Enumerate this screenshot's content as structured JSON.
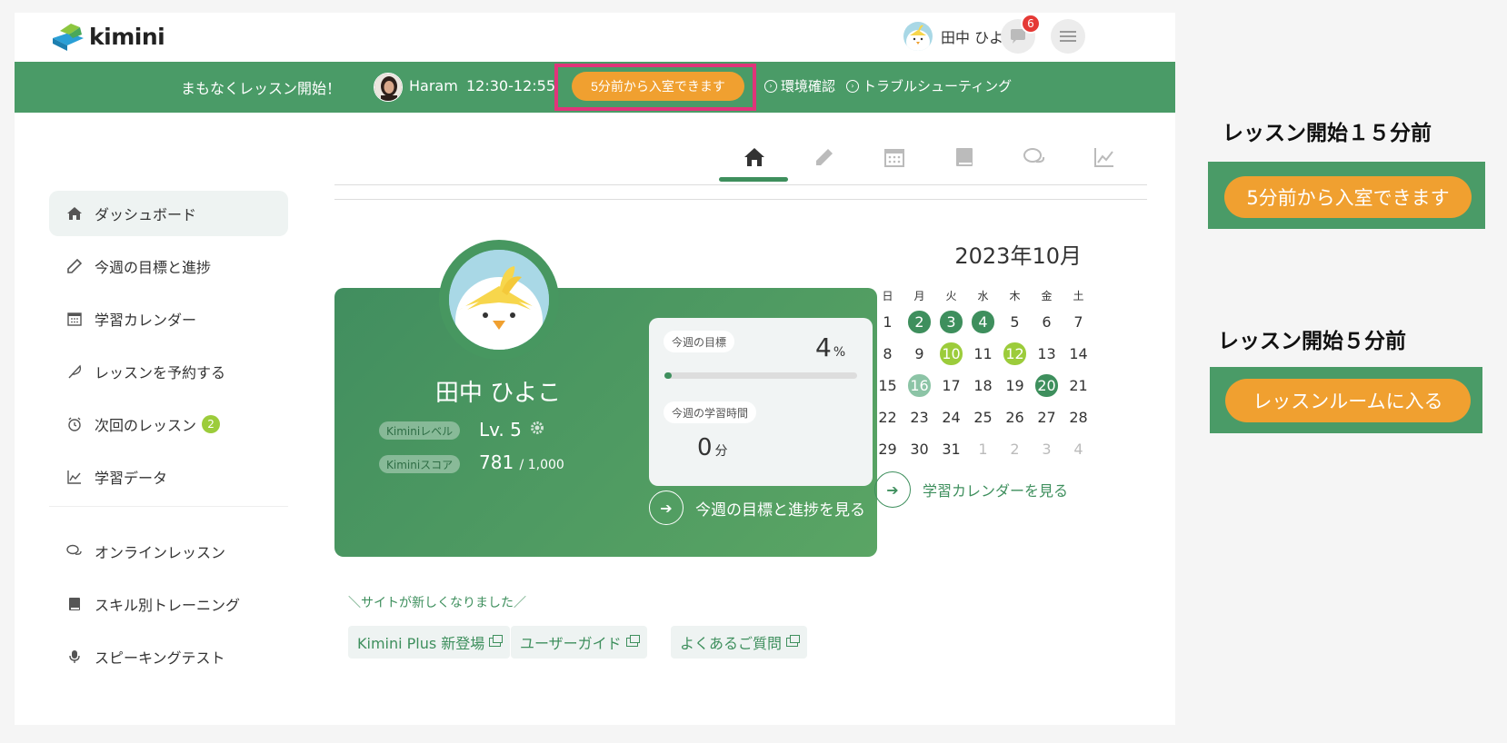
{
  "header": {
    "logo_text": "kimini",
    "user_name": "田中 ひよこ",
    "notification_count": "6"
  },
  "banner": {
    "message": "まもなくレッスン開始！",
    "teacher_name": "Haram",
    "lesson_time": "12:30-12:55",
    "enter_button": "5分前から入室できます",
    "links": [
      "環境確認",
      "トラブルシューティング"
    ]
  },
  "sidebar": {
    "items": [
      {
        "label": "ダッシュボード",
        "icon": "home-icon",
        "active": true
      },
      {
        "label": "今週の目標と進捗",
        "icon": "pencil-icon"
      },
      {
        "label": "学習カレンダー",
        "icon": "calendar-icon"
      },
      {
        "label": "レッスンを予約する",
        "icon": "feather-icon"
      },
      {
        "label": "次回のレッスン",
        "icon": "alarm-clock-icon",
        "badge": "2"
      },
      {
        "label": "学習データ",
        "icon": "chart-icon"
      }
    ],
    "secondary_items": [
      {
        "label": "オンラインレッスン",
        "icon": "chat-bubbles-icon"
      },
      {
        "label": "スキル別トレーニング",
        "icon": "book-icon"
      },
      {
        "label": "スピーキングテスト",
        "icon": "microphone-icon"
      }
    ]
  },
  "tabs": [
    "home-icon",
    "pencil-icon",
    "calendar-icon",
    "book-icon",
    "chat-icon",
    "chart-icon"
  ],
  "profile": {
    "name": "田中 ひよこ",
    "level_label": "Kiminiレベル",
    "level_value": "Lv. 5",
    "score_label": "Kiminiスコア",
    "score_value": "781",
    "score_max": "/ 1,000",
    "weekly_goal_label": "今週の目標",
    "weekly_goal_value": "4",
    "weekly_goal_unit": "%",
    "weekly_goal_progress": 0.04,
    "study_time_label": "今週の学習時間",
    "study_time_value": "0",
    "study_time_unit": "分",
    "link_text": "今週の目標と進捗を見る"
  },
  "calendar": {
    "title": "2023年10月",
    "weekdays": [
      "日",
      "月",
      "火",
      "水",
      "木",
      "金",
      "土"
    ],
    "weeks": [
      [
        {
          "d": "1"
        },
        {
          "d": "2",
          "s": "dark"
        },
        {
          "d": "3",
          "s": "dark"
        },
        {
          "d": "4",
          "s": "dark"
        },
        {
          "d": "5"
        },
        {
          "d": "6"
        },
        {
          "d": "7"
        }
      ],
      [
        {
          "d": "8"
        },
        {
          "d": "9"
        },
        {
          "d": "10",
          "s": "lime"
        },
        {
          "d": "11"
        },
        {
          "d": "12",
          "s": "lime"
        },
        {
          "d": "13"
        },
        {
          "d": "14"
        }
      ],
      [
        {
          "d": "15"
        },
        {
          "d": "16",
          "s": "pale"
        },
        {
          "d": "17"
        },
        {
          "d": "18"
        },
        {
          "d": "19"
        },
        {
          "d": "20",
          "s": "dark"
        },
        {
          "d": "21"
        }
      ],
      [
        {
          "d": "22"
        },
        {
          "d": "23"
        },
        {
          "d": "24"
        },
        {
          "d": "25"
        },
        {
          "d": "26"
        },
        {
          "d": "27"
        },
        {
          "d": "28"
        }
      ],
      [
        {
          "d": "29"
        },
        {
          "d": "30"
        },
        {
          "d": "31"
        },
        {
          "d": "1",
          "s": "muted"
        },
        {
          "d": "2",
          "s": "muted"
        },
        {
          "d": "3",
          "s": "muted"
        },
        {
          "d": "4",
          "s": "muted"
        }
      ]
    ],
    "link_text": "学習カレンダーを見る"
  },
  "notice": {
    "text": "＼サイトが新しくなりました／",
    "chips": [
      "Kimini Plus 新登場",
      "ユーザーガイド",
      "よくあるご質問"
    ]
  },
  "annotations": {
    "first_title": "レッスン開始１５分前",
    "first_button": "5分前から入室できます",
    "second_title": "レッスン開始５分前",
    "second_button": "レッスンルームに入る"
  },
  "colors": {
    "brand_green": "#4a9b67",
    "accent_orange": "#f0a030",
    "highlight_pink": "#e0357a",
    "badge_lime": "#9ccc3b"
  }
}
